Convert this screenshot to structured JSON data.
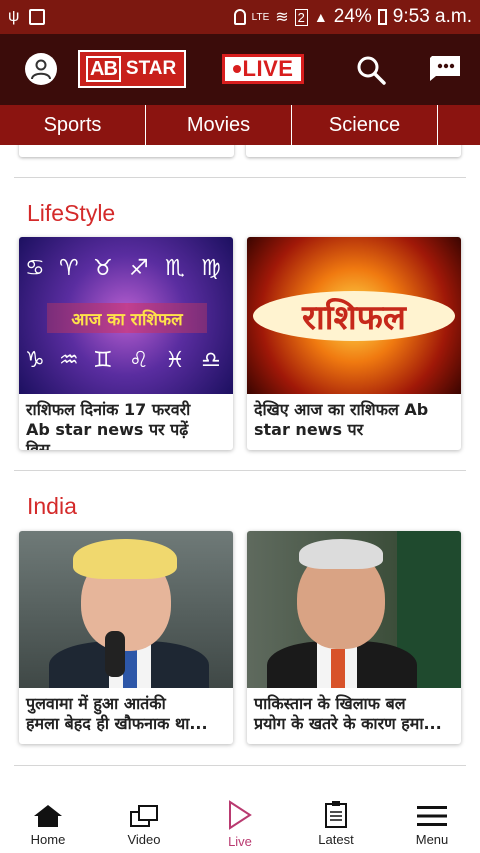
{
  "status_bar": {
    "battery": "24%",
    "time": "9:53 a.m.",
    "sim_badge": "2",
    "network": "LTE"
  },
  "app_bar": {
    "logo_ab": "AB",
    "logo_star": "STAR",
    "live_label": "LIVE"
  },
  "tabs": [
    {
      "label": "Sports"
    },
    {
      "label": "Movies"
    },
    {
      "label": "Science"
    }
  ],
  "sections": [
    {
      "title": "LifeStyle",
      "cards": [
        {
          "caption": "राशिफल दिनांक 17 फरवरी\nAb star news पर पढ़ें विस्...",
          "image_text": "आज का राशिफल"
        },
        {
          "caption": "देखिए आज का राशिफल Ab\nstar news पर",
          "image_text": "राशिफल"
        }
      ]
    },
    {
      "title": "India",
      "cards": [
        {
          "caption": "पुलवामा में हुआ आतंकी\nहमला बेहद ही खौफनाक था..."
        },
        {
          "caption": "पाकिस्तान के खिलाफ बल\nप्रयोग के खतरे के कारण हमा..."
        }
      ]
    }
  ],
  "bottom_nav": [
    {
      "label": "Home",
      "icon": "home-icon"
    },
    {
      "label": "Video",
      "icon": "video-icon"
    },
    {
      "label": "Live",
      "icon": "play-icon"
    },
    {
      "label": "Latest",
      "icon": "clipboard-icon"
    },
    {
      "label": "Menu",
      "icon": "menu-icon"
    }
  ],
  "colors": {
    "status_bar": "#7c1810",
    "app_bar": "#3b0c0a",
    "tab_bar": "#8b1410",
    "section_title": "#d42a2a",
    "live_active": "#b93a70"
  }
}
